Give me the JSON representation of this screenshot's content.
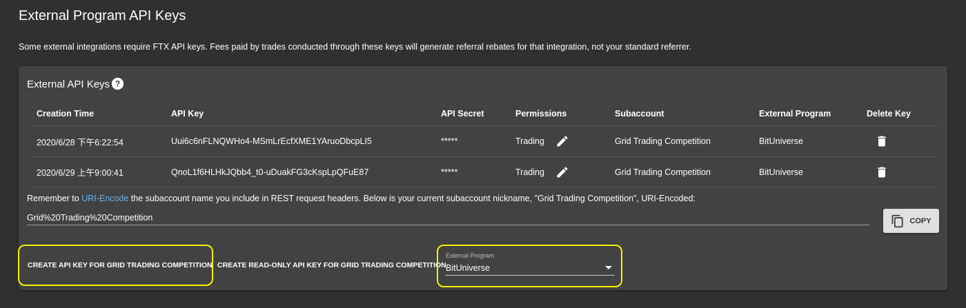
{
  "page": {
    "title": "External Program API Keys",
    "intro": "Some external integrations require FTX API keys. Fees paid by trades conducted through these keys will generate referral rebates for that integration, not your standard referrer."
  },
  "card": {
    "title": "External API Keys",
    "help_icon": "help-circle-icon",
    "columns": [
      "Creation Time",
      "API Key",
      "API Secret",
      "Permissions",
      "Subaccount",
      "External Program",
      "Delete Key"
    ],
    "rows": [
      {
        "creation_time": "2020/6/28 下午6:22:54",
        "api_key": "Uui6c6nFLNQWHo4-MSmLrEcfXME1YAruoDbcpLI5",
        "api_secret": "*****",
        "permissions": "Trading",
        "subaccount": "Grid Trading Competition",
        "external_program": "BitUniverse"
      },
      {
        "creation_time": "2020/6/29 上午9:00:41",
        "api_key": "QnoL1f6HLHkJQbb4_t0-uDuakFG3cKspLpQFuE87",
        "api_secret": "*****",
        "permissions": "Trading",
        "subaccount": "Grid Trading Competition",
        "external_program": "BitUniverse"
      }
    ],
    "remember": {
      "prefix": "Remember to ",
      "link": "URI-Encode",
      "suffix": " the subaccount name you include in REST request headers. Below is your current subaccount nickname, \"Grid Trading Competition\", URI-Encoded:"
    },
    "encoded_value": "Grid%20Trading%20Competition",
    "copy_label": "COPY",
    "create_button": "CREATE API KEY FOR GRID TRADING COMPETITION",
    "create_readonly_button": "CREATE READ-ONLY API KEY FOR GRID TRADING COMPETITION",
    "select": {
      "label": "External Program",
      "value": "BitUniverse"
    }
  },
  "colors": {
    "background": "#303030",
    "card": "#424242",
    "link": "#64b5f6",
    "highlight": "#f5f200"
  }
}
